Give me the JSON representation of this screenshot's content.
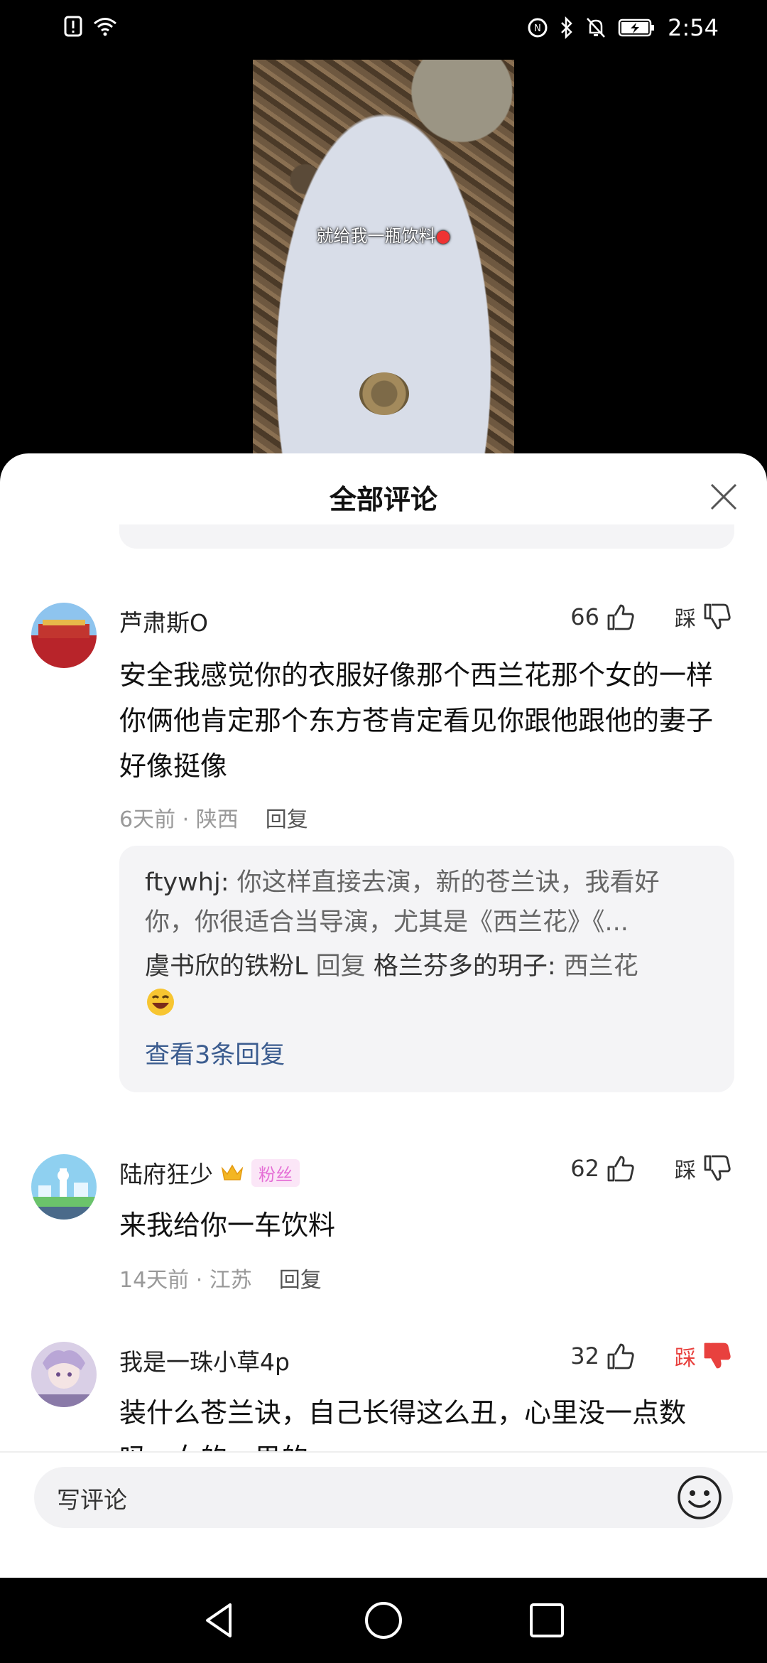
{
  "status_bar": {
    "time": "2:54",
    "icons": [
      "alert-icon",
      "wifi-icon",
      "nfc-icon",
      "bluetooth-icon",
      "mute-bell-icon",
      "battery-charging-icon"
    ]
  },
  "video": {
    "caption": "就给我一瓶饮料"
  },
  "sheet": {
    "title": "全部评论"
  },
  "comments": [
    {
      "user": "芦肃斯O",
      "likes": "66",
      "dislike_label": "踩",
      "text": "安全我感觉你的衣服好像那个西兰花那个女的一样你俩他肯定那个东方苍肯定看见你跟他跟他的妻子好像挺像",
      "time": "6天前",
      "location": "陕西",
      "reply_label": "回复",
      "replies": [
        {
          "name": "ftywhj",
          "text": "你这样直接去演，新的苍兰诀，我看好你，你很适合当导演，尤其是《西兰花》《..."
        },
        {
          "name": "虞书欣的铁粉L",
          "reply_word": "回复",
          "target": "格兰芬多的玥子",
          "text": "西兰花"
        }
      ],
      "view_more": "查看3条回复"
    },
    {
      "user": "陆府狂少",
      "badge": "粉丝",
      "likes": "62",
      "dislike_label": "踩",
      "text": "来我给你一车饮料",
      "time": "14天前",
      "location": "江苏",
      "reply_label": "回复"
    },
    {
      "user": "我是一珠小草4p",
      "likes": "32",
      "dislike_label": "踩",
      "dislike_active": true,
      "text": "装什么苍兰诀，自己长得这么丑，心里没一点数吗，女的，男的"
    }
  ],
  "input": {
    "placeholder": "写评论"
  },
  "colors": {
    "accent_link": "#3b5c8f",
    "dislike_active": "#e8413e",
    "badge_pink": "#e56fd6"
  }
}
